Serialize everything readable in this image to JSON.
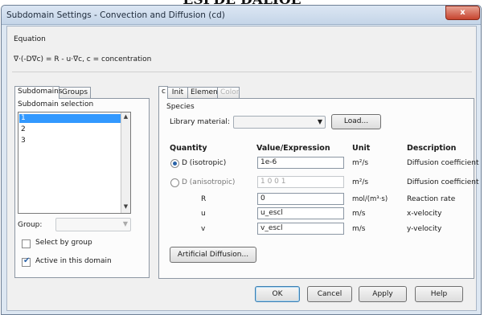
{
  "page_caption": "ESPDE DALIOE",
  "window": {
    "title": "Subdomain Settings - Convection and Diffusion (cd)",
    "close_glyph": "x"
  },
  "equation": {
    "label": "Equation",
    "text": "∇·(-D∇c) = R - u·∇c, c = concentration"
  },
  "left_tabs": [
    {
      "label": "Subdomains",
      "active": true
    },
    {
      "label": "Groups",
      "active": false
    }
  ],
  "subdomain_selection": {
    "label": "Subdomain selection",
    "items": [
      "1",
      "2",
      "3"
    ],
    "selected_index": 0
  },
  "group": {
    "label": "Group:",
    "value": ""
  },
  "select_by_group": {
    "label": "Select by group",
    "checked": false
  },
  "active_in_domain": {
    "label": "Active in this domain",
    "checked": true
  },
  "right_tabs": [
    {
      "label": "c",
      "state": "active"
    },
    {
      "label": "Init",
      "state": "normal"
    },
    {
      "label": "Element",
      "state": "normal"
    },
    {
      "label": "Color",
      "state": "disabled"
    }
  ],
  "species": {
    "label": "Species",
    "library_label": "Library material:",
    "library_value": "",
    "load_button": "Load..."
  },
  "table": {
    "headers": [
      "Quantity",
      "Value/Expression",
      "Unit",
      "Description"
    ],
    "rows": [
      {
        "quantity": "D (isotropic)",
        "value": "1e-6",
        "unit": "m²/s",
        "description": "Diffusion coefficient",
        "radio": true,
        "radio_selected": true,
        "dim": false
      },
      {
        "quantity": "D (anisotropic)",
        "value": "1 0 0 1",
        "unit": "m²/s",
        "description": "Diffusion coefficient",
        "radio": true,
        "radio_selected": false,
        "dim": true
      },
      {
        "quantity": "R",
        "value": "0",
        "unit": "mol/(m³·s)",
        "description": "Reaction rate",
        "radio": false,
        "radio_selected": false,
        "dim": false
      },
      {
        "quantity": "u",
        "value": "u_escl",
        "unit": "m/s",
        "description": "x-velocity",
        "radio": false,
        "radio_selected": false,
        "dim": false
      },
      {
        "quantity": "v",
        "value": "v_escl",
        "unit": "m/s",
        "description": "y-velocity",
        "radio": false,
        "radio_selected": false,
        "dim": false
      }
    ]
  },
  "artificial_diffusion_button": "Artificial Diffusion...",
  "footer_buttons": {
    "ok": "OK",
    "cancel": "Cancel",
    "apply": "Apply",
    "help": "Help"
  },
  "colors": {
    "selection": "#3399ff",
    "close_button": "#c7442e",
    "window_frame": "#dde7f2"
  }
}
